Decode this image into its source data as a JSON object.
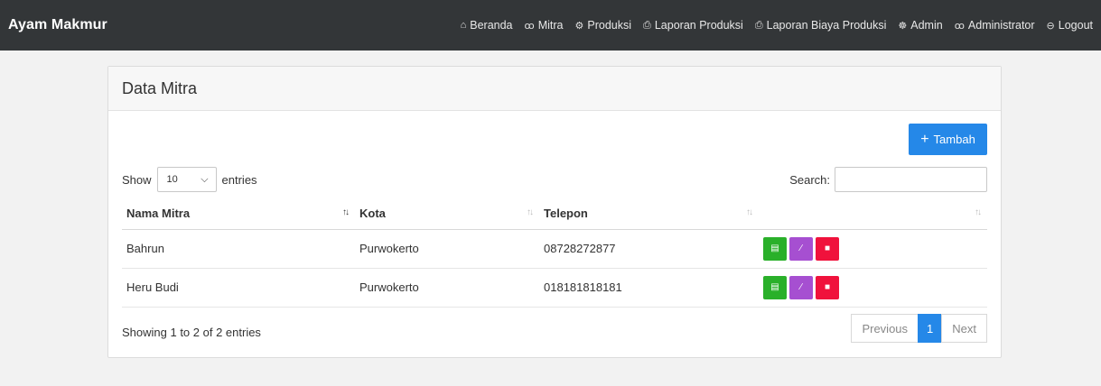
{
  "navbar": {
    "brand": "Ayam Makmur",
    "items": [
      {
        "icon": "home-icon",
        "glyph": "⌂",
        "label": "Beranda"
      },
      {
        "icon": "users-icon",
        "glyph": "ꝏ",
        "label": "Mitra"
      },
      {
        "icon": "gear-icon",
        "glyph": "⚙",
        "label": "Produksi"
      },
      {
        "icon": "printer-icon",
        "glyph": "⎙",
        "label": "Laporan Produksi"
      },
      {
        "icon": "printer-icon",
        "glyph": "⎙",
        "label": "Laporan Biaya Produksi"
      },
      {
        "icon": "group-icon",
        "glyph": "☸",
        "label": "Admin"
      },
      {
        "icon": "user-icon",
        "glyph": "ꝏ",
        "label": "Administrator"
      },
      {
        "icon": "logout-icon",
        "glyph": "⊖",
        "label": "Logout"
      }
    ]
  },
  "card": {
    "title": "Data Mitra",
    "add_button": "Tambah",
    "add_glyph": "+"
  },
  "length": {
    "prefix": "Show",
    "value": "10",
    "suffix": "entries"
  },
  "search": {
    "label": "Search:",
    "value": ""
  },
  "table": {
    "columns": [
      "Nama Mitra",
      "Kota",
      "Telepon",
      ""
    ],
    "rows": [
      {
        "nama": "Bahrun",
        "kota": "Purwokerto",
        "telepon": "08728272877"
      },
      {
        "nama": "Heru Budi",
        "kota": "Purwokerto",
        "telepon": "018181818181"
      }
    ]
  },
  "footer": {
    "info": "Showing 1 to 2 of 2 entries",
    "previous": "Previous",
    "page": "1",
    "next": "Next"
  },
  "colors": {
    "navbar_bg": "#333638",
    "primary": "#2588e8",
    "view": "#2ab02a",
    "edit": "#a64fd1",
    "delete": "#f0123c"
  }
}
